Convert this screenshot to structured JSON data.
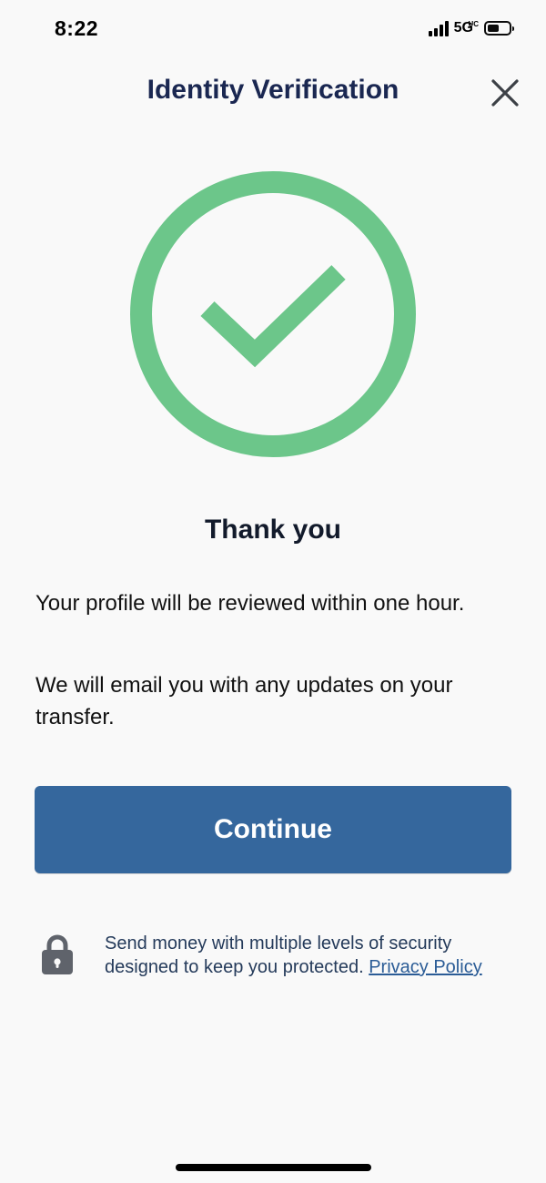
{
  "status_bar": {
    "time": "8:22",
    "network": "5G",
    "network_suffix": "UC",
    "signal_bars": 4,
    "battery_level_percent": 55
  },
  "header": {
    "title": "Identity Verification",
    "close_icon": "close-icon"
  },
  "success": {
    "icon": "check-circle-icon",
    "color": "#6cc68a",
    "title": "Thank you"
  },
  "messages": [
    "Your profile will be reviewed within one hour.",
    "We will email you with any updates on your transfer."
  ],
  "continue_button": {
    "label": "Continue",
    "color": "#35679d"
  },
  "security_note": {
    "icon": "lock-icon",
    "text": "Send money with multiple levels of security designed to keep you protected. ",
    "link_label": "Privacy Policy"
  }
}
